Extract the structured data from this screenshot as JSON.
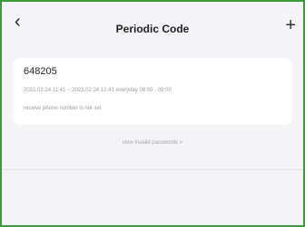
{
  "header": {
    "title": "Periodic Code",
    "back_icon": "chevron-left-icon",
    "add_icon": "plus-icon"
  },
  "codes": [
    {
      "code": "648205",
      "period": "2022.02.24 11:41 ~ 2023.02.24 12:41 everyday 08:00 - 09:00",
      "receiver": "receive phone number is not set"
    }
  ],
  "footer": {
    "invalid_link": "view invalid passwords >"
  },
  "colors": {
    "border": "#3a9d3a",
    "background": "#f4f4f6",
    "card": "#ffffff"
  }
}
